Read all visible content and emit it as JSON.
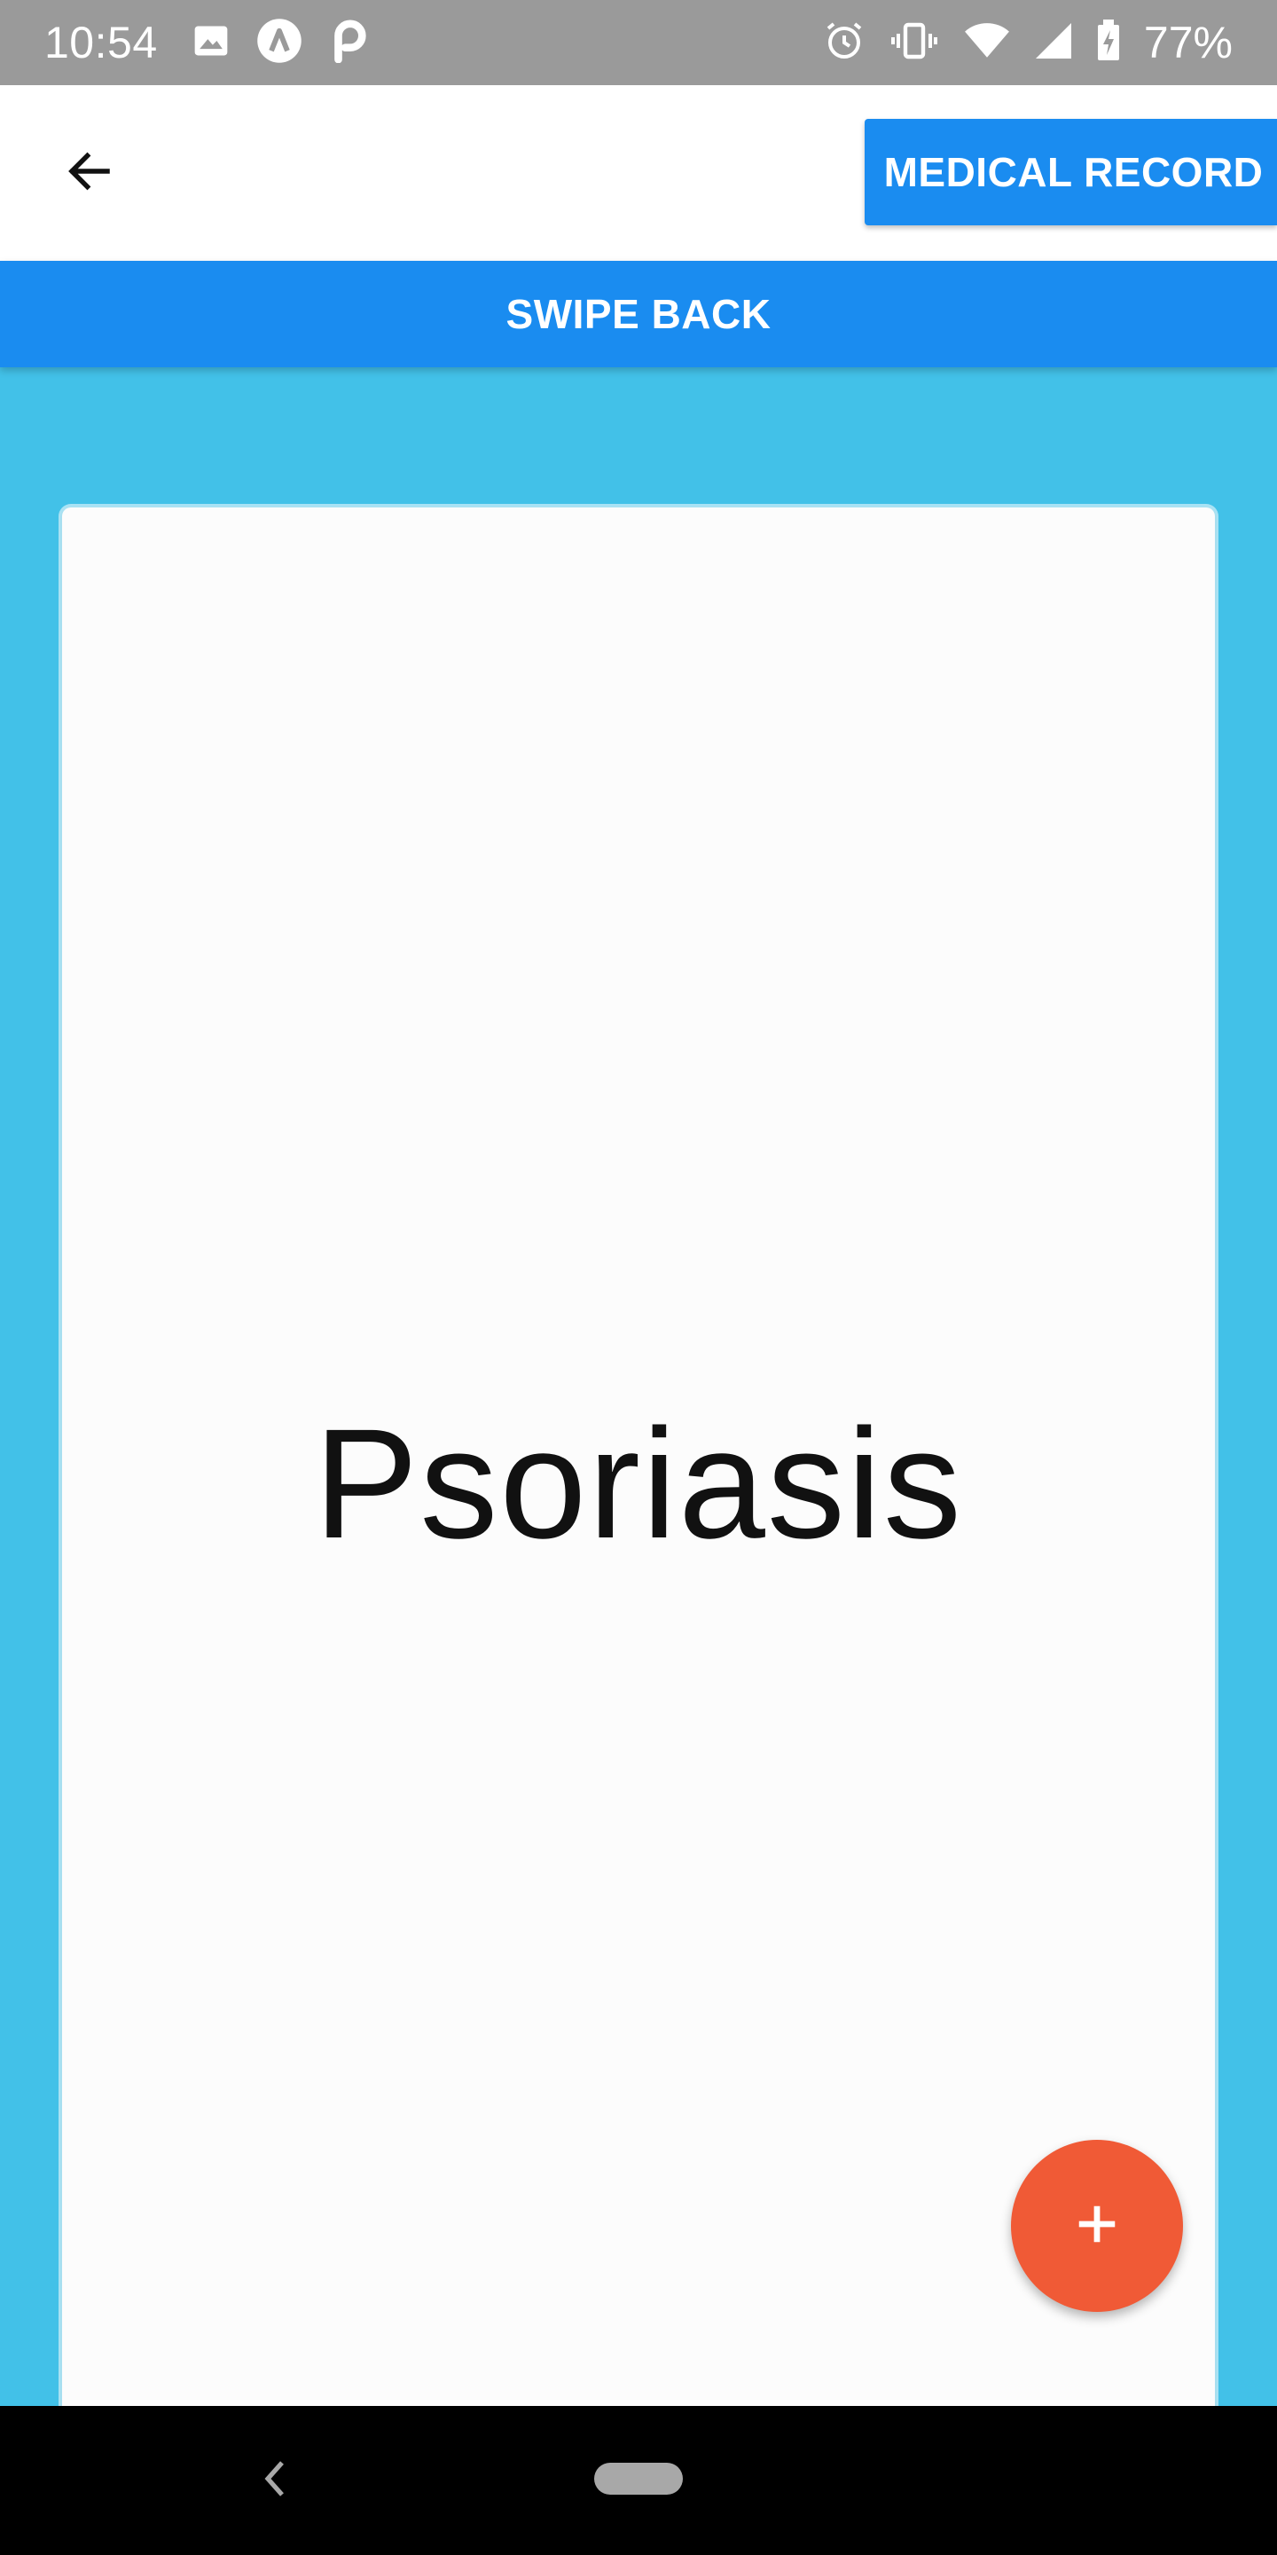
{
  "status_bar": {
    "time": "10:54",
    "battery": "77%",
    "left_icons": [
      "image-icon",
      "triangle-badge-icon",
      "p-badge-icon"
    ],
    "right_icons": [
      "alarm-icon",
      "vibrate-icon",
      "wifi-icon",
      "signal-icon",
      "battery-charging-icon"
    ]
  },
  "app_bar": {
    "back_icon": "arrow-back-icon",
    "medical_record_label": "MEDICAL RECORD"
  },
  "swipe_back_label": "SWIPE BACK",
  "card": {
    "title": "Psoriasis"
  },
  "fab": {
    "icon": "plus-icon"
  },
  "nav_bar": {
    "back_icon": "chevron-left-icon",
    "home_icon": "home-pill-icon"
  },
  "colors": {
    "accent_blue": "#1A8CF0",
    "background_cyan": "#42C1E8",
    "fab_orange": "#F05A36",
    "status_bar_gray": "#9A9A9A"
  }
}
